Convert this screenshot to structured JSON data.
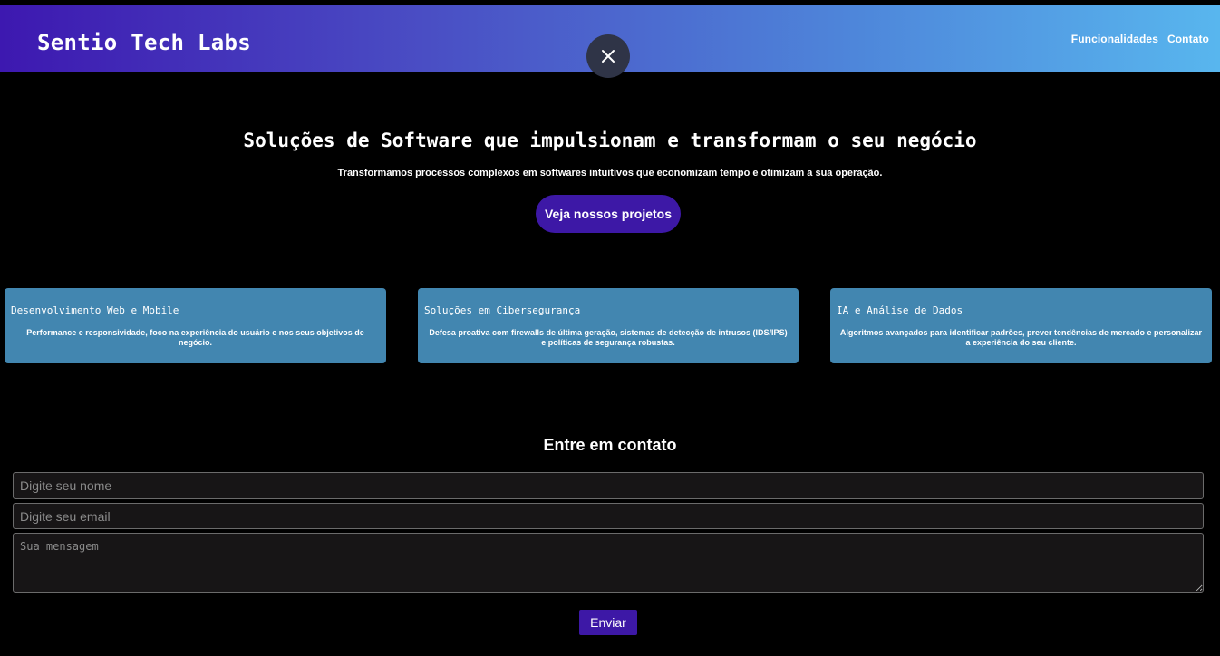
{
  "header": {
    "brand": "Sentio Tech Labs",
    "nav": [
      "Funcionalidades",
      "Contato"
    ]
  },
  "overlay": {
    "close_icon": "close-icon"
  },
  "hero": {
    "title": "Soluções de Software que impulsionam e transformam o seu negócio",
    "subtitle": "Transformamos processos complexos em softwares intuitivos que economizam tempo e otimizam a sua operação.",
    "cta": "Veja nossos projetos"
  },
  "features": [
    {
      "title": "Desenvolvimento Web e Mobile",
      "text": "Performance e responsividade, foco na experiência do usuário e nos seus objetivos de negócio."
    },
    {
      "title": "Soluções em Cibersegurança",
      "text": "Defesa proativa com firewalls de última geração, sistemas de detecção de intrusos (IDS/IPS) e políticas de segurança robustas."
    },
    {
      "title": "IA e Análise de Dados",
      "text": "Algoritmos avançados para identificar padrões, prever tendências de mercado e personalizar a experiência do seu cliente."
    }
  ],
  "contact": {
    "title": "Entre em contato",
    "name_placeholder": "Digite seu nome",
    "email_placeholder": "Digite seu email",
    "message_placeholder": "Sua mensagem",
    "submit": "Enviar"
  },
  "colors": {
    "header_gradient_start": "#3d18b0",
    "header_gradient_end": "#58b6ee",
    "accent_button": "#3d18a6",
    "card_bg": "#4286b0",
    "close_button_bg": "#2f3447"
  }
}
